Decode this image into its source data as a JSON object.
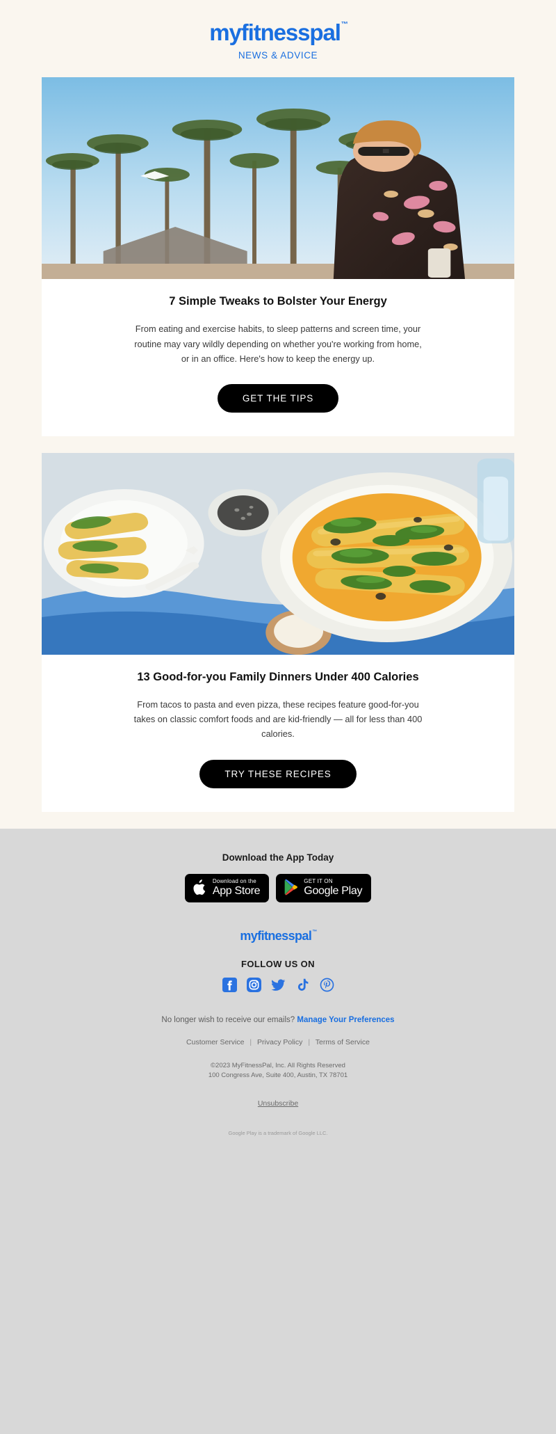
{
  "brand": {
    "name": "myfitnesspal",
    "tm": "™",
    "tagline": "NEWS & ADVICE",
    "blue": "#1a6fe0"
  },
  "articles": [
    {
      "image_name": "woman-palm-trees-sunglasses-floral-jacket",
      "title": "7 Simple Tweaks to Bolster Your Energy",
      "text": "From eating and exercise habits, to sleep patterns and screen time, your routine may vary wildly depending on whether you're working from home, or in an office. Here's how to keep the energy up.",
      "cta": "GET THE TIPS"
    },
    {
      "image_name": "enchiladas-plate-cilantro-sauce",
      "title": "13 Good-for-you Family Dinners Under 400 Calories",
      "text": "From tacos to pasta and even pizza, these recipes feature good-for-you takes on classic comfort foods and are kid-friendly — all for less than 400 calories.",
      "cta": "TRY THESE RECIPES"
    }
  ],
  "footer": {
    "download_heading": "Download the App Today",
    "badges": [
      {
        "small": "Download on the",
        "big": "App Store",
        "icon": "apple-icon"
      },
      {
        "small": "GET IT ON",
        "big": "Google Play",
        "icon": "google-play-icon"
      }
    ],
    "follow_heading": "FOLLOW US ON",
    "socials": [
      "facebook-icon",
      "instagram-icon",
      "twitter-icon",
      "tiktok-icon",
      "pinterest-icon"
    ],
    "pref_text": "No longer wish to receive our emails?",
    "pref_link": "Manage Your Preferences",
    "links": [
      "Customer Service",
      "Privacy Policy",
      "Terms of Service"
    ],
    "link_separator": "|",
    "copyright": "©2023 MyFitnessPal, Inc. All Rights Reserved",
    "address": "100 Congress Ave, Suite 400, Austin, TX 78701",
    "unsubscribe": "Unsubscribe",
    "google_tm": "Google Play is a trademark of Google LLC."
  }
}
